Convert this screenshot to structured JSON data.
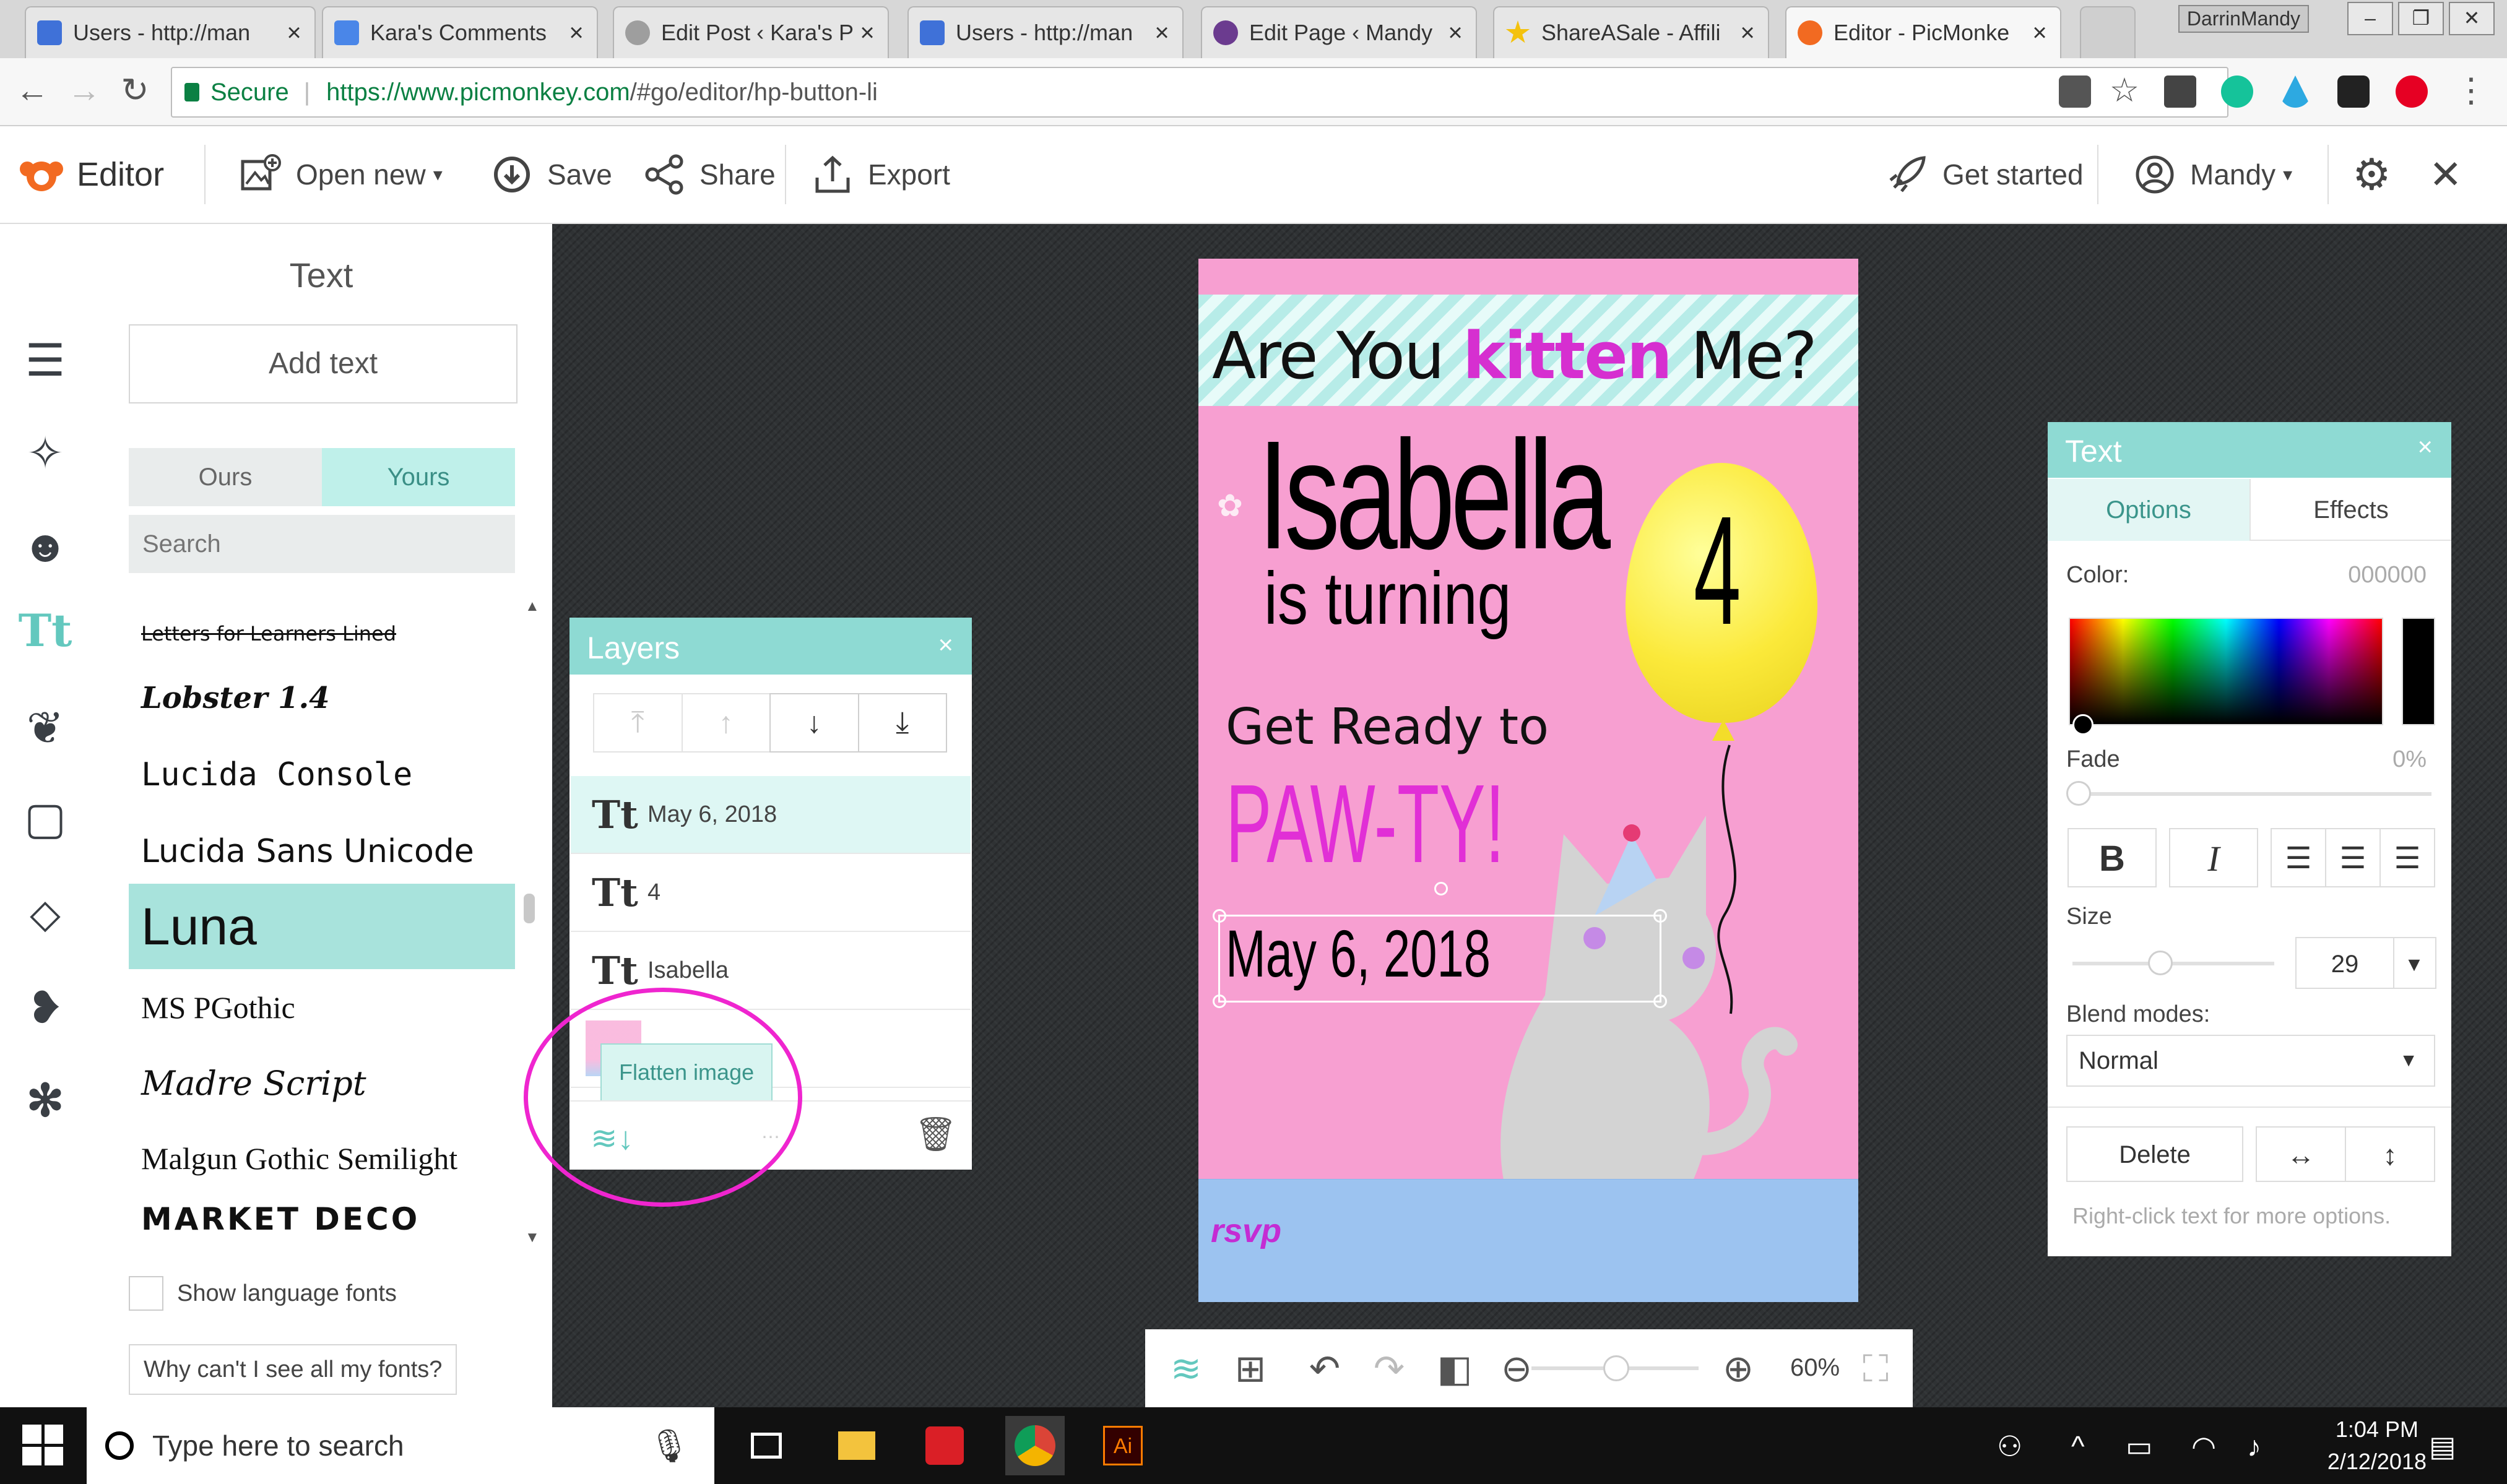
{
  "browser": {
    "tabs": [
      {
        "label": "Users - http://man",
        "icon": "grid-icon"
      },
      {
        "label": "Kara's Comments",
        "icon": "docs-icon"
      },
      {
        "label": "Edit Post ‹ Kara's P",
        "icon": "wordpress-icon"
      },
      {
        "label": "Users - http://man",
        "icon": "grid-icon"
      },
      {
        "label": "Edit Page ‹ Mandy",
        "icon": "site-icon"
      },
      {
        "label": "ShareASale - Affili",
        "icon": "star-icon"
      },
      {
        "label": "Editor - PicMonke",
        "icon": "picmonkey-icon"
      }
    ],
    "profile": "DarrinMandy",
    "secure_label": "Secure",
    "url_host": "https://www.picmonkey.com",
    "url_path": "/#go/editor/hp-button-li"
  },
  "header": {
    "app_name": "Editor",
    "open_new": "Open new",
    "save": "Save",
    "share": "Share",
    "export": "Export",
    "get_started": "Get started",
    "user": "Mandy"
  },
  "text_panel": {
    "title": "Text",
    "add_text": "Add text",
    "tab_ours": "Ours",
    "tab_yours": "Yours",
    "search_placeholder": "Search",
    "fonts": [
      "Letters for Learners Lined",
      "Lobster 1.4",
      "Lucida Console",
      "Lucida Sans Unicode",
      "Luna",
      "MS PGothic",
      "Madre Script",
      "Malgun Gothic Semilight",
      "MARKET DECO"
    ],
    "selected_font": "Luna",
    "show_language_fonts": "Show language fonts",
    "why_fonts": "Why can't I see all my fonts?"
  },
  "invitation": {
    "headline_a": "Are You ",
    "headline_kitten": "kitten",
    "headline_b": " Me?",
    "name": "Isabella",
    "is_turning": "is turning",
    "age": "4",
    "get_ready": "Get Ready to",
    "pawty": "PAW-TY!",
    "date": "May 6, 2018",
    "rsvp": "rsvp"
  },
  "layers": {
    "title": "Layers",
    "rows": [
      {
        "label": "May 6, 2018",
        "selected": true
      },
      {
        "label": "4",
        "selected": false
      },
      {
        "label": "Isabella",
        "selected": false
      }
    ],
    "tooltip": "Flatten image"
  },
  "text_options": {
    "title": "Text",
    "tab_options": "Options",
    "tab_effects": "Effects",
    "color_label": "Color:",
    "color_value": "000000",
    "fade_label": "Fade",
    "fade_value": "0%",
    "bold": "B",
    "italic": "I",
    "size_label": "Size",
    "size_value": "29",
    "blend_label": "Blend modes:",
    "blend_value": "Normal",
    "delete": "Delete",
    "hint": "Right-click text for more options."
  },
  "bottombar": {
    "zoom": "60%"
  },
  "taskbar": {
    "search_placeholder": "Type here to search",
    "time": "1:04 PM",
    "date": "2/12/2018"
  },
  "colors": {
    "accent_teal": "#8edad3",
    "invite_pink": "#f79fd1",
    "highlight_magenta": "#ef25cf"
  }
}
